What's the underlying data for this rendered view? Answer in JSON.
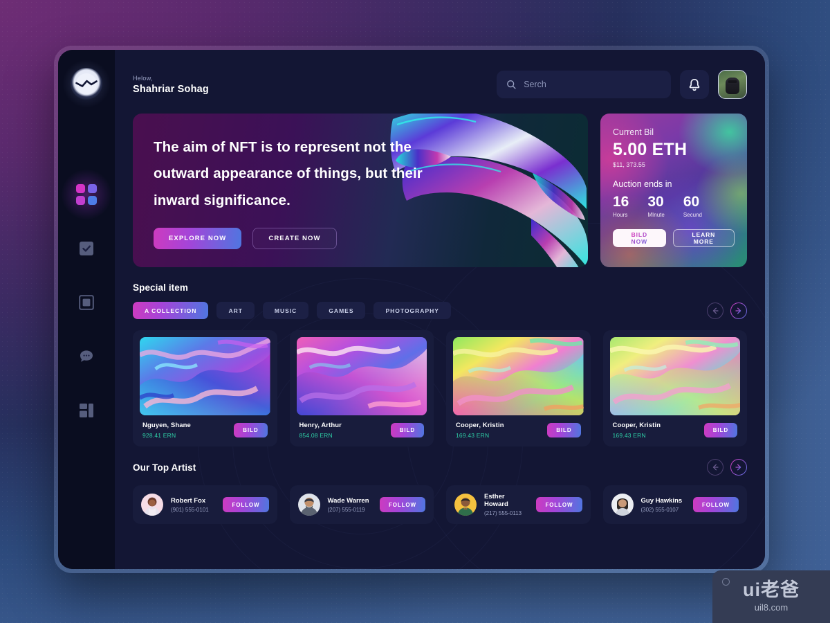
{
  "header": {
    "greeting_small": "Helow,",
    "greeting_name": "Shahriar Sohag",
    "search_placeholder": "Serch",
    "search_value": "",
    "search_icon": "search-icon",
    "bell_icon": "bell-icon",
    "avatar_label": "user-avatar"
  },
  "sidebar": {
    "logo_label": "app-logo",
    "items": [
      {
        "icon": "grid-icon",
        "label": "Dashboard",
        "active": true
      },
      {
        "icon": "check-square-icon",
        "label": "Tasks",
        "active": false
      },
      {
        "icon": "frame-icon",
        "label": "Collection",
        "active": false
      },
      {
        "icon": "chat-bubble-icon",
        "label": "Messages",
        "active": false
      },
      {
        "icon": "layout-icon",
        "label": "Stats",
        "active": false
      }
    ]
  },
  "hero": {
    "headline": "The aim of NFT is to represent not the outward appearance of things, but their inward significance.",
    "primary_button": "EXPLORE NOW",
    "secondary_button": "CREATE NOW",
    "artwork_label": "holographic-hand-image"
  },
  "bill": {
    "title": "Current Bil",
    "amount": "5.00 ETH",
    "usd": "$11, 373.55",
    "auction_label": "Auction ends in",
    "countdown": [
      {
        "value": "16",
        "unit": "Hours"
      },
      {
        "value": "30",
        "unit": "MInute"
      },
      {
        "value": "60",
        "unit": "Secund"
      }
    ],
    "primary_button": "BILD NOW",
    "secondary_button": "LEARN MORE"
  },
  "special": {
    "title": "Special item",
    "tabs": [
      {
        "label": "A COLLECTION",
        "active": true
      },
      {
        "label": "ART",
        "active": false
      },
      {
        "label": "MUSIC",
        "active": false
      },
      {
        "label": "GAMES",
        "active": false
      },
      {
        "label": "PHOTOGRAPHY",
        "active": false
      }
    ],
    "prev_icon": "arrow-left-icon",
    "next_icon": "arrow-right-icon",
    "cards": [
      {
        "name": "Nguyen, Shane",
        "price": "928.41 ERN",
        "button": "BILD",
        "art": "fluid-art-cyan-purple"
      },
      {
        "name": "Henry, Arthur",
        "price": "854.08 ERN",
        "button": "BILD",
        "art": "fluid-art-pink-magenta"
      },
      {
        "name": "Cooper, Kristin",
        "price": "169.43 ERN",
        "button": "BILD",
        "art": "fluid-art-rainbow-green"
      },
      {
        "name": "Cooper, Kristin",
        "price": "169.43 ERN",
        "button": "BILD",
        "art": "fluid-art-rainbow-pastel"
      }
    ]
  },
  "artists": {
    "title": "Our Top Artist",
    "prev_icon": "arrow-left-icon",
    "next_icon": "arrow-right-icon",
    "items": [
      {
        "name": "Robert Fox",
        "phone": "(901) 555-0101",
        "button": "FOLLOW"
      },
      {
        "name": "Wade Warren",
        "phone": "(207) 555-0119",
        "button": "FOLLOW"
      },
      {
        "name": "Esther Howard",
        "phone": "(217) 555-0113",
        "button": "FOLLOW"
      },
      {
        "name": "Guy Hawkins",
        "phone": "(302) 555-0107",
        "button": "FOLLOW"
      }
    ]
  },
  "watermark": {
    "top": "ui老爸",
    "sub": "uil8.com"
  },
  "colors": {
    "accent_magenta": "#cd3bbf",
    "accent_blue": "#4f76e0",
    "price_green": "#2fd2a8",
    "panel": "#181c3c",
    "screen_bg": "#131634",
    "sidebar_bg": "#0a0d20"
  }
}
